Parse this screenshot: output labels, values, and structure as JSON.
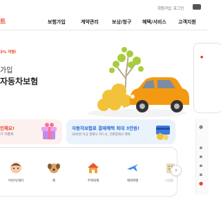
{
  "header": {
    "util_links": [
      "회원가입",
      "로그인"
    ],
    "logo": "트",
    "nav": [
      "보험가입",
      "계약관리",
      "보상/청구",
      "혜택/서비스",
      "고객지원"
    ]
  },
  "hero": {
    "badge": "3% 저렴!",
    "line1": "가입",
    "line2": "자동차보험"
  },
  "banners": {
    "left": {
      "title": "인해요!",
      "subtitle": "기 이벤트"
    },
    "right": {
      "title": "자동차보험료 결제혜택 최대 3만원!",
      "subtitle": "30만원 이상 결제시 카드사, 간편결제사 혜택"
    }
  },
  "categories": [
    {
      "label": "어린이/태아",
      "icon": "child-icon"
    },
    {
      "label": "펫",
      "icon": "dog-icon"
    },
    {
      "label": "주택화재",
      "icon": "house-icon"
    },
    {
      "label": "해외여행",
      "icon": "airplane-icon"
    },
    {
      "label": "시설물",
      "icon": "building-icon"
    }
  ],
  "colors": {
    "accent": "#e8442e",
    "blue": "#2a6ad6",
    "car": "#f39a12"
  }
}
